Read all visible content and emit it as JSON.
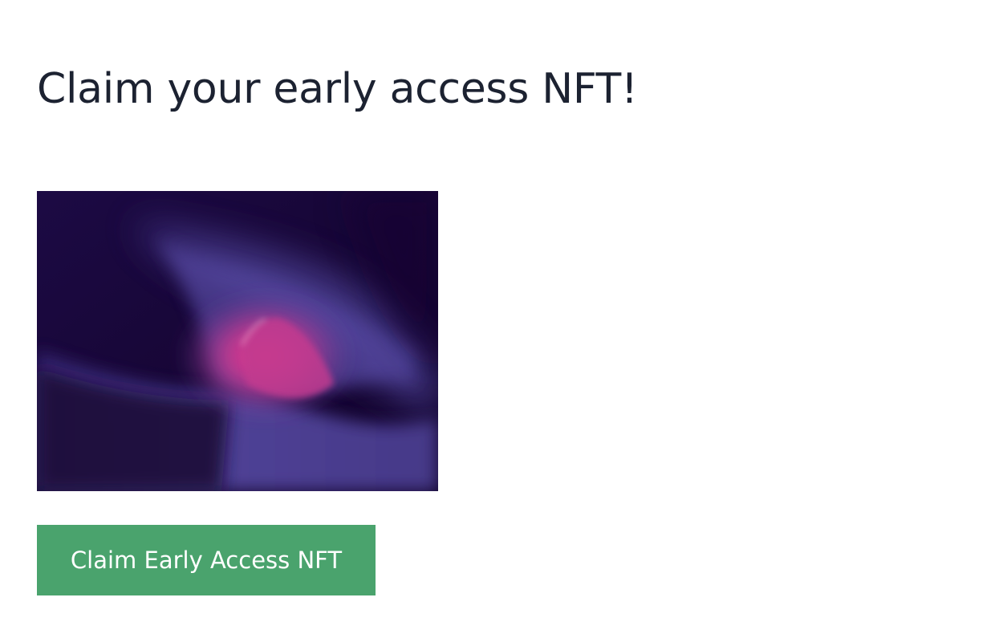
{
  "page": {
    "title": "Claim your early access NFT!"
  },
  "nft": {
    "image_name": "nft-artwork-image",
    "palette": {
      "background": "#1a0840",
      "violet": "#53459a",
      "pink": "#e93a8d"
    }
  },
  "actions": {
    "claim_label": "Claim Early Access NFT",
    "claim_color": "#4aa36d"
  }
}
